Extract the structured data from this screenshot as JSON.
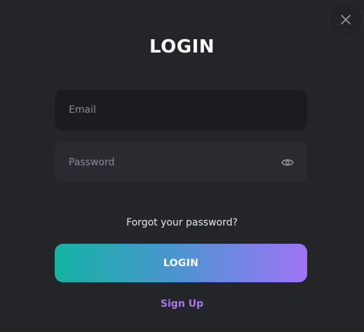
{
  "modal": {
    "title": "LOGIN",
    "close_icon": "close-icon"
  },
  "form": {
    "email": {
      "placeholder": "Email",
      "value": ""
    },
    "password": {
      "placeholder": "Password",
      "value": "",
      "toggle_icon": "eye-icon"
    },
    "forgot_label": "Forgot your password?",
    "submit_label": "LOGIN",
    "signup_label": "Sign Up"
  },
  "colors": {
    "background": "#242529",
    "email_field": "#1b1c1f",
    "password_field": "#2a2b30",
    "gradient_start": "#14b3a4",
    "gradient_end": "#9e74f5",
    "signup_link": "#a877ee"
  }
}
